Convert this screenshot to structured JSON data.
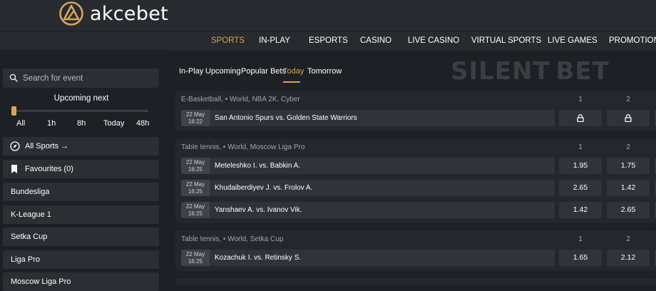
{
  "brand": {
    "name": "akcebet",
    "accent": "#d6a55a"
  },
  "nav": {
    "items": [
      "SPORTS",
      "IN-PLAY",
      "ESPORTS",
      "CASINO",
      "LIVE CASINO",
      "VIRTUAL SPORTS",
      "LIVE GAMES",
      "PROMOTIONS"
    ],
    "active": "SPORTS"
  },
  "sidebar": {
    "search_placeholder": "Search for event",
    "upcoming_title": "Upcoming next",
    "time_options": [
      "All",
      "1h",
      "8h",
      "Today",
      "48h"
    ],
    "all_sports": "All Sports →",
    "favourites": "Favourites (0)",
    "leagues": [
      "Bundesliga",
      "K-League 1",
      "Setka Cup",
      "Liga Pro",
      "Moscow Liga Pro"
    ]
  },
  "tabs": {
    "items": [
      "In-Play",
      "Upcoming",
      "Popular Bets",
      "Today",
      "Tomorrow"
    ],
    "active": "Today"
  },
  "watermark": "SILENT BET",
  "events": {
    "b1": {
      "league": "E-Basketball, • World, NBA 2K. Cyber",
      "col1": "1",
      "col2": "2",
      "rows": [
        {
          "date": "22 May",
          "time": "16:22",
          "teams": "San Antonio Spurs vs. Golden State Warriors",
          "odd1": "locked",
          "odd2": "locked"
        }
      ]
    },
    "b2": {
      "league": "Table tennis, • World, Moscow Liga Pro",
      "col1": "1",
      "col2": "2",
      "rows": [
        {
          "date": "22 May",
          "time": "16:25",
          "teams": "Meteleshko I. vs. Babkin A.",
          "odd1": "1.95",
          "odd2": "1.75"
        },
        {
          "date": "22 May",
          "time": "16:25",
          "teams": "Khudaiberdiyev J. vs. Frolov A.",
          "odd1": "2.65",
          "odd2": "1.42"
        },
        {
          "date": "22 May",
          "time": "16:25",
          "teams": "Yanshaev A. vs. Ivanov Vik.",
          "odd1": "1.42",
          "odd2": "2.65"
        }
      ]
    },
    "b3": {
      "league": "Table tennis, • World, Setka Cup",
      "col1": "1",
      "col2": "2",
      "rows": [
        {
          "date": "22 May",
          "time": "16:25",
          "teams": "Kozachuk I. vs. Retinsky S.",
          "odd1": "1.65",
          "odd2": "2.12"
        }
      ]
    }
  }
}
